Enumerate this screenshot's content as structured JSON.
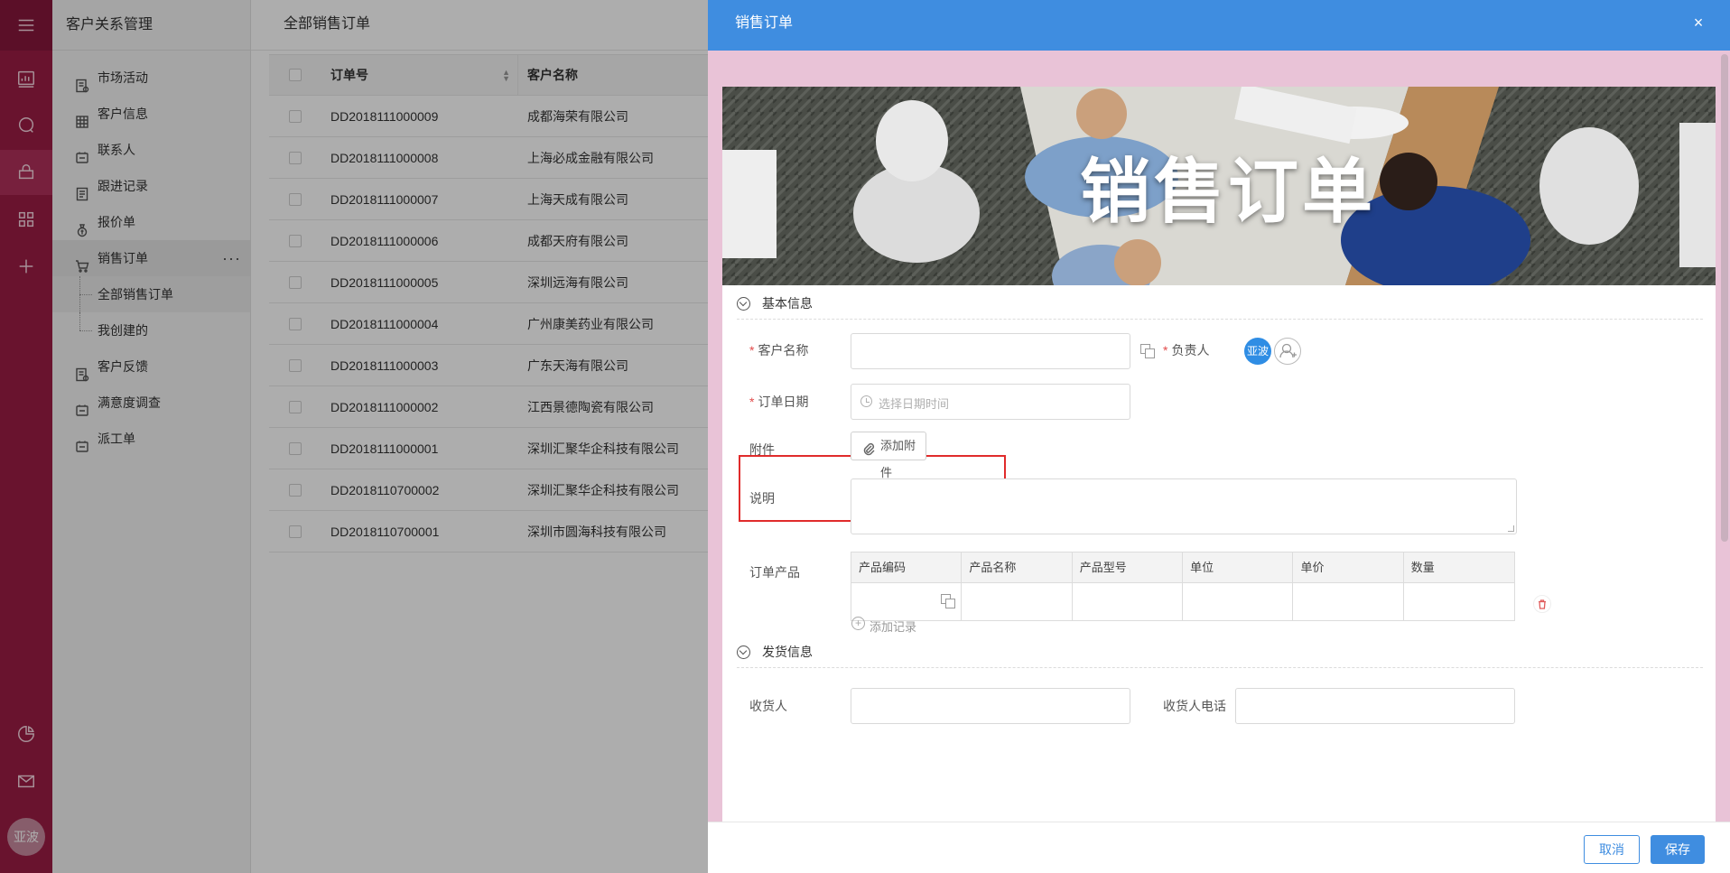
{
  "rail": {
    "avatar_text": "亚波"
  },
  "subnav": {
    "title": "客户关系管理",
    "items": [
      {
        "label": "市场活动"
      },
      {
        "label": "客户信息"
      },
      {
        "label": "联系人"
      },
      {
        "label": "跟进记录"
      },
      {
        "label": "报价单"
      },
      {
        "label": "销售订单",
        "more": "···"
      },
      {
        "label": "全部销售订单"
      },
      {
        "label": "我创建的"
      },
      {
        "label": "客户反馈"
      },
      {
        "label": "满意度调查"
      },
      {
        "label": "派工单"
      }
    ]
  },
  "main": {
    "title": "全部销售订单",
    "columns": [
      "订单号",
      "客户名称"
    ],
    "rows": [
      [
        "DD2018111000009",
        "成都海荣有限公司"
      ],
      [
        "DD2018111000008",
        "上海必成金融有限公司"
      ],
      [
        "DD2018111000007",
        "上海天成有限公司"
      ],
      [
        "DD2018111000006",
        "成都天府有限公司"
      ],
      [
        "DD2018111000005",
        "深圳远海有限公司"
      ],
      [
        "DD2018111000004",
        "广州康美药业有限公司"
      ],
      [
        "DD2018111000003",
        "广东天海有限公司"
      ],
      [
        "DD2018111000002",
        "江西景德陶瓷有限公司"
      ],
      [
        "DD2018111000001",
        "深圳汇聚华企科技有限公司"
      ],
      [
        "DD2018110700002",
        "深圳汇聚华企科技有限公司"
      ],
      [
        "DD2018110700001",
        "深圳市圆海科技有限公司"
      ]
    ]
  },
  "drawer": {
    "title": "销售订单",
    "close": "×",
    "banner_text": "销售订单",
    "sections": {
      "basic": "基本信息",
      "shipping": "发货信息"
    },
    "fields": {
      "customer_name_label": "客户名称",
      "owner_label": "负责人",
      "owner_avatar": "亚波",
      "order_date_label": "订单日期",
      "order_date_placeholder": "选择日期时间",
      "attachment_label": "附件",
      "attachment_button": "添加附件",
      "description_label": "说明",
      "products_label": "订单产品",
      "receiver_label": "收货人",
      "receiver_phone_label": "收货人电话",
      "required_mark": "*"
    },
    "product_columns": [
      "产品编码",
      "产品名称",
      "产品型号",
      "单位",
      "单价",
      "数量"
    ],
    "add_record": "添加记录",
    "buttons": {
      "cancel": "取消",
      "save": "保存"
    }
  }
}
